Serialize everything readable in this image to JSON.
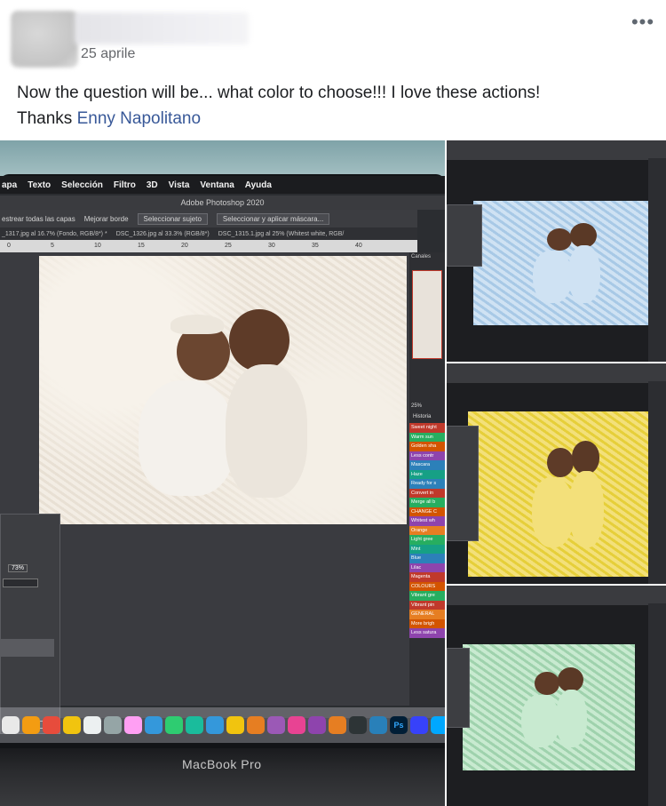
{
  "post": {
    "date": "25 aprile",
    "more_label": "•••",
    "text_before_mention": "Now the question will be... what color to choose!!! I love these actions!",
    "thanks": "Thanks ",
    "mention": "Enny Napolitano"
  },
  "main_photo": {
    "menubar": [
      "apa",
      "Texto",
      "Selección",
      "Filtro",
      "3D",
      "Vista",
      "Ventana",
      "Ayuda"
    ],
    "app_title": "Adobe Photoshop 2020",
    "options": [
      "estrear todas las capas",
      "Mejorar borde",
      "Seleccionar sujeto",
      "Seleccionar y aplicar máscara..."
    ],
    "tabs": [
      "_1317.jpg al 16.7% (Fondo, RGB/8*) *",
      "DSC_1326.jpg al 33.3% (RGB/8*)",
      "DSC_1315.1.jpg al 25% (Whitest white, RGB/"
    ],
    "ruler": [
      "0",
      "5",
      "10",
      "15",
      "20",
      "25",
      "30",
      "35",
      "40"
    ],
    "panel_label": "Canales",
    "history_label": "Historia",
    "zoom": "25%",
    "float_zoom": "73%",
    "actions": [
      "Sweet night",
      "Warm sun",
      "Golden sha",
      "Less contr",
      "Mascara",
      "Haze",
      "Ready for s",
      "Convert in",
      "Merge all b",
      "CHANGE C",
      "Whitest wh",
      "Orange",
      "Light gree",
      "Mint",
      "Blue",
      "Lilac",
      "Magenta",
      "COLOURS",
      "Vibrant gre",
      "Vibrant pin",
      "GENERAL",
      "More brigh",
      "Less satura"
    ],
    "action_colors": [
      "#c0392b",
      "#27ae60",
      "#d35400",
      "#8e44ad",
      "#2c80b9",
      "#16a085",
      "#2c80b9",
      "#c0392b",
      "#27ae60",
      "#d35400",
      "#8e44ad",
      "#e67e22",
      "#27ae60",
      "#16a085",
      "#2c80b9",
      "#8e44ad",
      "#c0392b",
      "#d35400",
      "#27ae60",
      "#c0392b",
      "#e67e22",
      "#d35400",
      "#8e44ad"
    ],
    "dock_colors": [
      "#e9e9e9",
      "#f39c12",
      "#e74c3c",
      "#f1c40f",
      "#ecf0f1",
      "#95a5a6",
      "#ff9ff3",
      "#3498db",
      "#2ecc71",
      "#1abc9c",
      "#3498db",
      "#f1c40f",
      "#e67e22",
      "#9b59b6",
      "#e84393",
      "#8e44ad",
      "#e67e22",
      "#2d3436",
      "#2980b9",
      "#ecf0f1",
      "#3742fa",
      "#00a8ff",
      "#222"
    ],
    "dock_ps": "Ps",
    "device_label": "MacBook Pro"
  },
  "thumbnails": [
    {
      "name": "blue",
      "bg": "#a8c9e6",
      "accent": "#cfe2f3"
    },
    {
      "name": "yellow",
      "bg": "#e6cf3a",
      "accent": "#f3e07a"
    },
    {
      "name": "green",
      "bg": "#9fd2ad",
      "accent": "#c8ead0"
    }
  ]
}
